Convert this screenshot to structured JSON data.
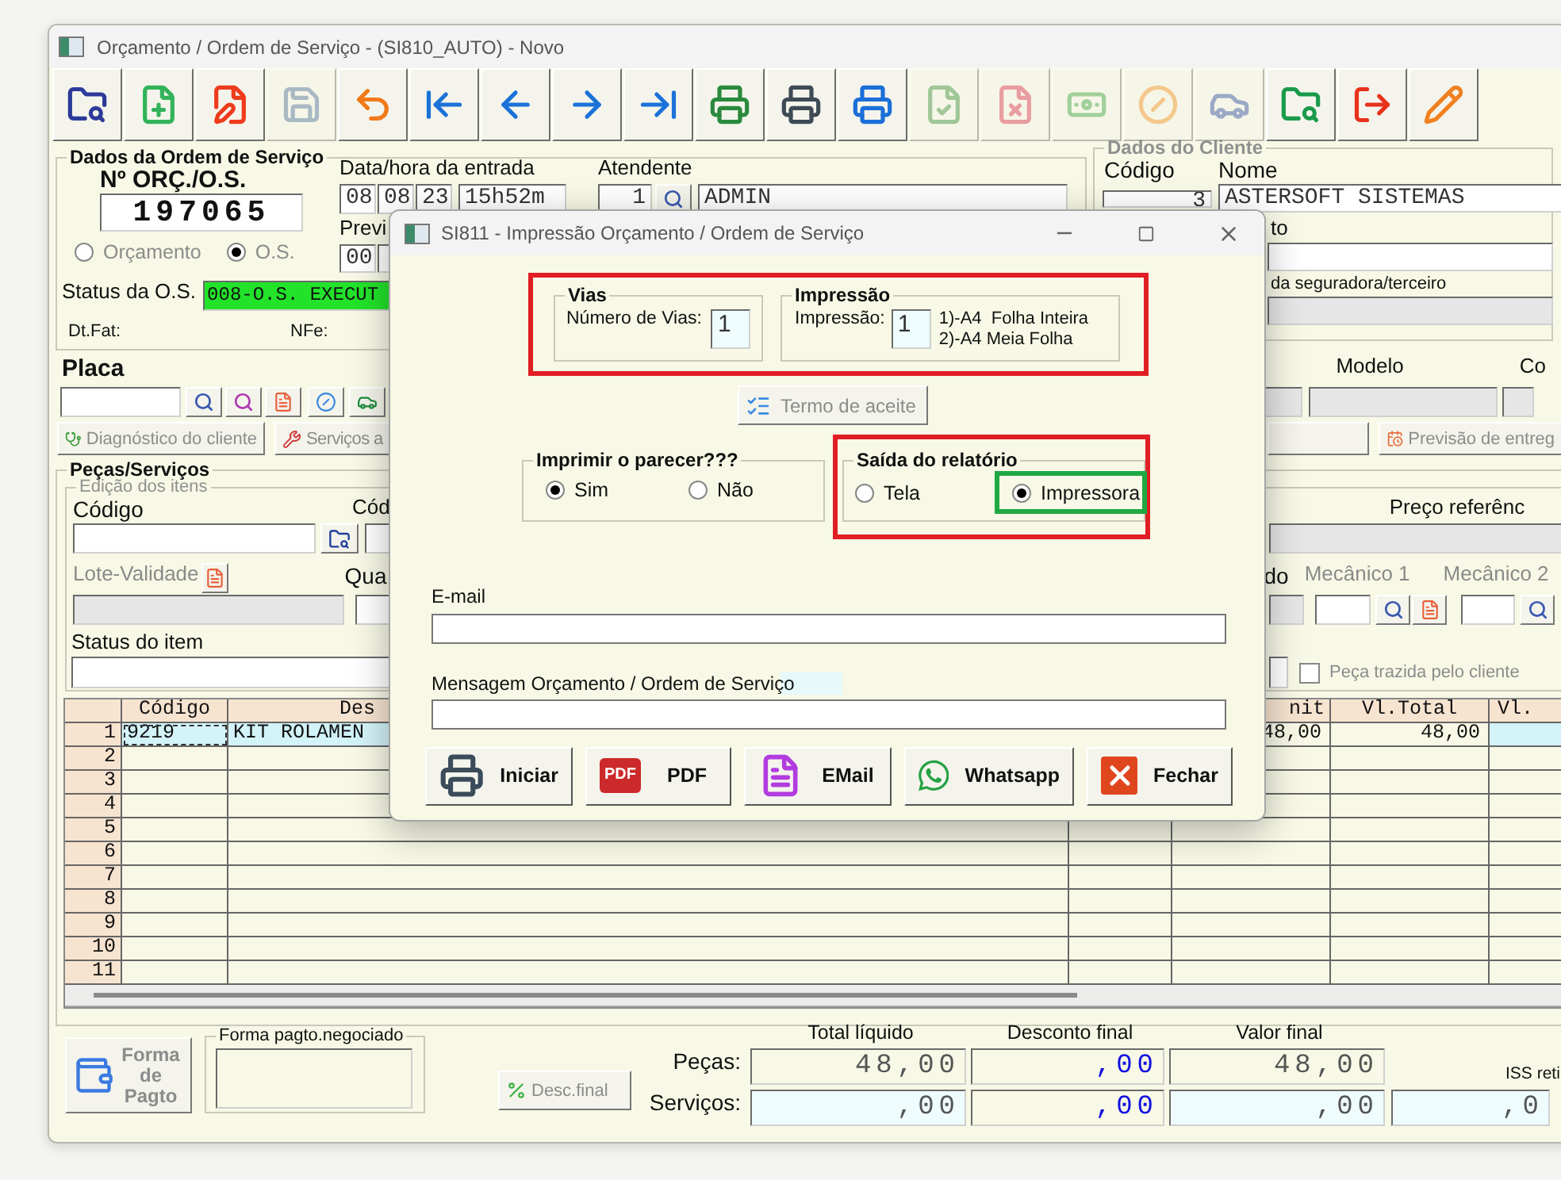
{
  "window": {
    "title": "Orçamento / Ordem de Serviço - (SI810_AUTO) - Novo"
  },
  "toolbar": [
    {
      "kind": "folder-search",
      "disabled": false
    },
    {
      "kind": "file-plus",
      "disabled": false
    },
    {
      "kind": "file-edit",
      "disabled": false
    },
    {
      "kind": "save",
      "disabled": true
    },
    {
      "kind": "undo",
      "disabled": false
    },
    {
      "kind": "first",
      "disabled": false
    },
    {
      "kind": "prev",
      "disabled": false
    },
    {
      "kind": "next",
      "disabled": false
    },
    {
      "kind": "last",
      "disabled": false
    },
    {
      "kind": "print-green",
      "disabled": false
    },
    {
      "kind": "print-dark",
      "disabled": false
    },
    {
      "kind": "print-blue",
      "disabled": false
    },
    {
      "kind": "file-check",
      "disabled": true
    },
    {
      "kind": "file-x",
      "disabled": true
    },
    {
      "kind": "cash-plus",
      "disabled": true
    },
    {
      "kind": "cash-ban",
      "disabled": true
    },
    {
      "kind": "car",
      "disabled": true
    },
    {
      "kind": "folder-search-green",
      "disabled": false
    },
    {
      "kind": "exit",
      "disabled": false
    },
    {
      "kind": "pencil",
      "disabled": false
    }
  ],
  "order": {
    "legend": "Dados da Ordem de Serviço",
    "number_label": "Nº ORÇ./O.S.",
    "number": "197065",
    "type_options": [
      {
        "label": "Orçamento",
        "selected": false,
        "disabled": true
      },
      {
        "label": "O.S.",
        "selected": true,
        "disabled": true
      }
    ],
    "entry_label": "Data/hora da entrada",
    "entry": [
      "08",
      "08",
      "23",
      "15h52m"
    ],
    "forecast_label": "Previ",
    "forecast": [
      "00"
    ],
    "attendant_label": "Atendente",
    "attendant_code": "1",
    "attendant_name": "ADMIN",
    "status_label": "Status da O.S.",
    "status": "008-O.S. EXECUT",
    "invoice_date_label": "Dt.Fat:",
    "nfe_label": "NFe:"
  },
  "client": {
    "legend": "Dados do Cliente",
    "code_label": "Código",
    "name_label": "Nome",
    "code": "3",
    "name": "ASTERSOFT SISTEMAS",
    "label_3": "to",
    "label_4": "da seguradora/terceiro"
  },
  "vehicle": {
    "plate_label": "Placa",
    "model_label": "Modelo",
    "column_3_label": "Co",
    "buttons": [
      {
        "label": "Diagnóstico do cliente",
        "disabled": true
      },
      {
        "label": "Serviços a",
        "disabled": true
      },
      {
        "label": "Previsão de entreg",
        "disabled": true
      }
    ]
  },
  "items": {
    "legend": "Peças/Serviços",
    "edit_legend": "Edição dos itens",
    "code_label": "Código",
    "code_label_2": "Cód",
    "lot_label": "Lote-Validade",
    "qty_label": "Qua",
    "status_label": "Status do item",
    "price_label": "Preço referênc",
    "label_7": "do",
    "mechanic_1_label": "Mecânico 1",
    "mechanic_2_label": "Mecânico 2",
    "brought_by_client": {
      "label": "Peça trazida pelo cliente",
      "checked": false
    }
  },
  "table": {
    "columns": [
      "Código",
      "Des",
      null,
      "nit",
      "Vl.Total",
      "Vl."
    ],
    "rows": [
      {
        "number": "1",
        "selected": true,
        "cells": [
          "9219",
          "KIT ROLAMEN",
          null,
          "48,00",
          "48,00",
          null
        ]
      },
      {
        "number": "2",
        "selected": false
      },
      {
        "number": "3",
        "selected": false
      },
      {
        "number": "4",
        "selected": false
      },
      {
        "number": "5",
        "selected": false
      },
      {
        "number": "6",
        "selected": false
      },
      {
        "number": "7",
        "selected": false
      },
      {
        "number": "8",
        "selected": false
      },
      {
        "number": "9",
        "selected": false
      },
      {
        "number": "10",
        "selected": false
      },
      {
        "number": "11",
        "selected": false
      }
    ]
  },
  "payment": {
    "button": {
      "label": "Forma de Pagto",
      "disabled": true
    },
    "negotiated_legend": "Forma pagto.negociado",
    "discount_button": {
      "label": "Desc.final",
      "disabled": true
    }
  },
  "totals": {
    "headers": [
      "Total líquido",
      "Desconto final",
      "Valor final"
    ],
    "iss_label": "ISS reti",
    "rows": [
      {
        "label": "Peças:",
        "values": [
          "48,00",
          ",00",
          "48,00"
        ]
      },
      {
        "label": "Serviços:",
        "values": [
          ",00",
          ",00",
          ",00",
          ",0"
        ]
      }
    ]
  },
  "dialog": {
    "title": "SI811 - Impressão Orçamento / Ordem de Serviço",
    "settings_highlighted": true,
    "copies": {
      "legend": "Vias",
      "label": "Número de Vias:",
      "value": "1"
    },
    "print": {
      "legend": "Impressão",
      "label": "Impressão:",
      "value": "1",
      "options": [
        "1)-A4  Folha Inteira",
        "2)-A4 Meia Folha"
      ]
    },
    "terms_button": {
      "label": "Termo de aceite",
      "disabled": true
    },
    "opinion": {
      "legend": "Imprimir o parecer???",
      "options": [
        {
          "label": "Sim",
          "selected": true
        },
        {
          "label": "Não",
          "selected": false
        }
      ]
    },
    "output": {
      "legend": "Saída do relatório",
      "highlighted": true,
      "options": [
        {
          "label": "Tela",
          "selected": false,
          "highlighted": false
        },
        {
          "label": "Impressora",
          "selected": true,
          "highlighted": true
        }
      ]
    },
    "email_label": "E-mail",
    "message_label": "Mensagem Orçamento / Ordem de Serviço",
    "buttons": [
      {
        "kind": "print",
        "label": "Iniciar"
      },
      {
        "kind": "pdf",
        "label": "PDF",
        "badge": "PDF"
      },
      {
        "kind": "email",
        "label": "EMail"
      },
      {
        "kind": "whatsapp",
        "label": "Whatsapp"
      },
      {
        "kind": "close",
        "label": "Fechar"
      }
    ]
  }
}
